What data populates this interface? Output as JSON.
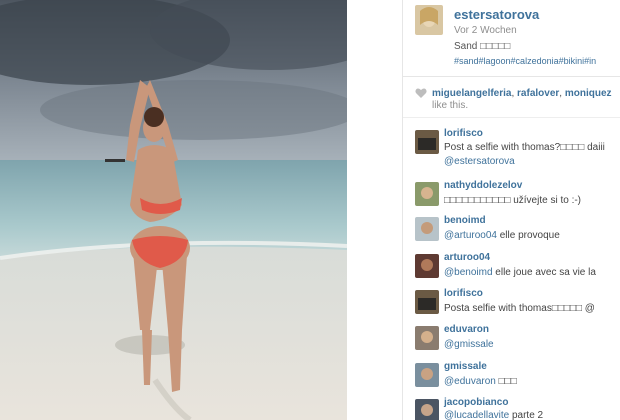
{
  "post": {
    "username": "estersatorova",
    "time": "Vor 2 Wochen",
    "caption": "Sand □□□□□",
    "tags": "#sand#lagoon#calzedonia#bikini#in"
  },
  "likes": {
    "users": [
      "miguelangelferia",
      "rafalover",
      "moniquez"
    ],
    "separator": ", ",
    "suffix": "like this."
  },
  "comments": [
    {
      "user": "lorifisco",
      "text": "Post a selfie with thomas?□□□□ daiii",
      "mention": "@estersatorova"
    },
    {
      "user": "nathyddolezelov",
      "text": "□□□□□□□□□□□ užívejte si to :-)"
    },
    {
      "user": "benoimd",
      "mention": "@arturoo04",
      "text": " elle provoque"
    },
    {
      "user": "arturoo04",
      "mention": "@benoimd",
      "text": " elle joue avec sa vie la"
    },
    {
      "user": "lorifisco",
      "text": "Posta selfie with thomas□□□□□ @"
    },
    {
      "user": "eduvaron",
      "mention": "@gmissale",
      "text": ""
    },
    {
      "user": "gmissale",
      "mention": "@eduvaron",
      "text": " □□□"
    },
    {
      "user": "jacopobianco",
      "mention": "@lucadellavite",
      "text": " parte 2"
    }
  ],
  "icons": {
    "heart": "heart-icon"
  }
}
